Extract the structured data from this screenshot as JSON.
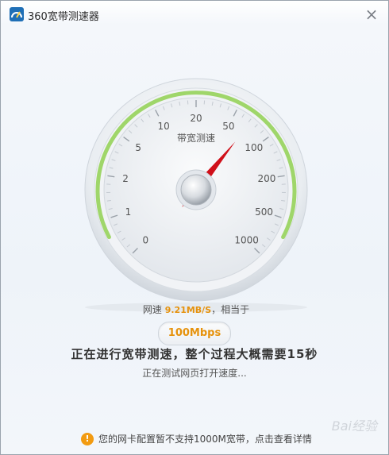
{
  "window": {
    "title": "360宽带测速器"
  },
  "gauge": {
    "label": "带宽测速",
    "scale": [
      "0",
      "1",
      "2",
      "5",
      "10",
      "20",
      "50",
      "100",
      "200",
      "500",
      "1000"
    ],
    "needle_value_mbps": 100,
    "speed_prefix": "网速",
    "speed_value": "9.21MB/S",
    "speed_suffix": "，相当于",
    "equivalent": "100Mbps"
  },
  "status": {
    "main": "正在进行宽带测速，整个过程大概需要15秒",
    "sub": "正在测试网页打开速度..."
  },
  "notice": {
    "text": "您的网卡配置暂不支持1000M宽带，点击查看详情"
  },
  "watermark": "Bai经验",
  "colors": {
    "accent": "#e6920c",
    "arc_green": "#9fd66a",
    "needle_red": "#d0101a",
    "warning": "#f29b11"
  }
}
